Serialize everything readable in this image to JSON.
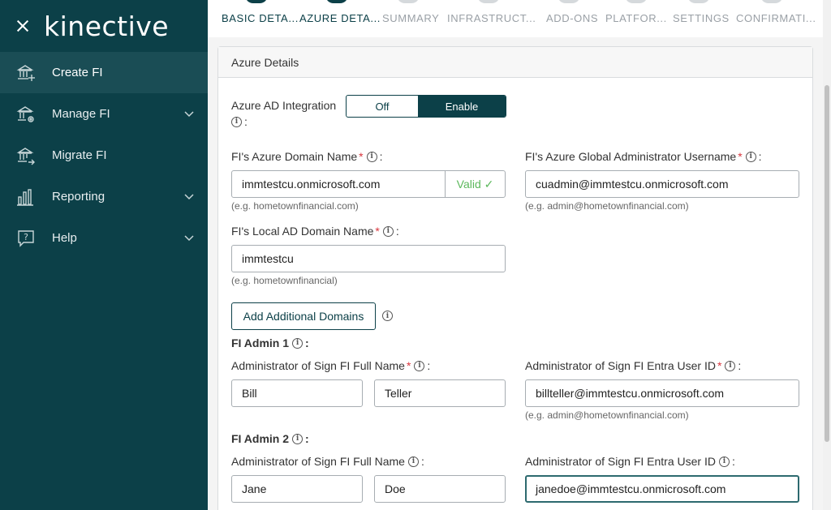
{
  "sidebar": {
    "logo": "kinective",
    "items": [
      {
        "label": "Create FI",
        "icon": "bank-add-icon",
        "active": true,
        "has_chevron": false
      },
      {
        "label": "Manage FI",
        "icon": "bank-gear-icon",
        "active": false,
        "has_chevron": true
      },
      {
        "label": "Migrate FI",
        "icon": "bank-arrow-icon",
        "active": false,
        "has_chevron": false
      },
      {
        "label": "Reporting",
        "icon": "bar-chart-icon",
        "active": false,
        "has_chevron": true
      },
      {
        "label": "Help",
        "icon": "help-icon",
        "active": false,
        "has_chevron": true
      }
    ]
  },
  "stepper": {
    "steps": [
      "BASIC DETA...",
      "AZURE DETA...",
      "SUMMARY",
      "INFRASTRUCT...",
      "ADD-ONS",
      "PLATFOR...",
      "SETTINGS",
      "CONFIRMATI..."
    ]
  },
  "card": {
    "title": "Azure Details",
    "azure_ad": {
      "label": "Azure AD Integration",
      "colon": ":",
      "off": "Off",
      "enable": "Enable"
    },
    "domain_name": {
      "label": "FI's Azure Domain Name",
      "value": "immtestcu.onmicrosoft.com",
      "status": "Valid ✓",
      "hint": "(e.g. hometownfinancial.com)"
    },
    "global_admin": {
      "label": "FI's Azure Global Administrator Username",
      "value": "cuadmin@immtestcu.onmicrosoft.com",
      "hint": "(e.g. admin@hometownfinancial.com)"
    },
    "local_ad": {
      "label": "FI's Local AD Domain Name",
      "value": "immtestcu",
      "hint": "(e.g. hometownfinancial)"
    },
    "add_domains_button": "Add Additional Domains",
    "admin1": {
      "heading": "FI Admin 1",
      "name_label": "Administrator of Sign FI Full Name",
      "first": "Bill",
      "last": "Teller",
      "id_label": "Administrator of Sign FI Entra User ID",
      "user_id": "billteller@immtestcu.onmicrosoft.com",
      "hint": "(e.g. admin@hometownfinancial.com)"
    },
    "admin2": {
      "heading": "FI Admin 2",
      "name_label": "Administrator of Sign FI Full Name",
      "first": "Jane",
      "last": "Doe",
      "id_label": "Administrator of Sign FI Entra User ID",
      "user_id": "janedoe@immtestcu.onmicrosoft.com"
    }
  },
  "symbols": {
    "required": "*",
    "colon": ":",
    "info": "i"
  }
}
